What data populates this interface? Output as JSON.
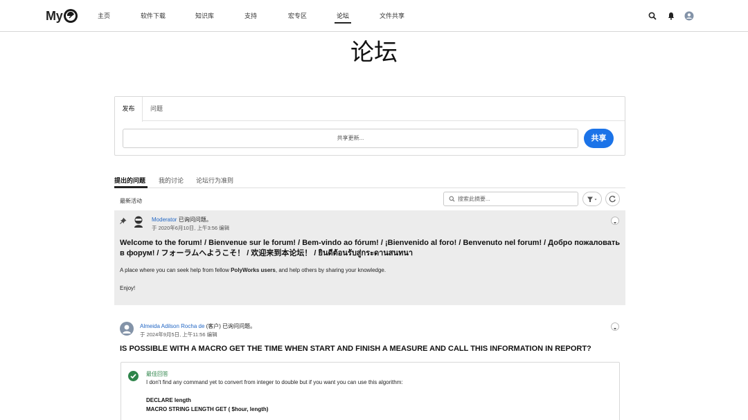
{
  "header": {
    "logo_text": "My",
    "nav": [
      {
        "label": "主页"
      },
      {
        "label": "软件下载"
      },
      {
        "label": "知识库"
      },
      {
        "label": "支持"
      },
      {
        "label": "宏专区"
      },
      {
        "label": "论坛"
      },
      {
        "label": "文件共享"
      }
    ],
    "active_nav": "论坛"
  },
  "page": {
    "title": "论坛"
  },
  "publisher": {
    "tabs": [
      "发布",
      "问题"
    ],
    "input_placeholder": "共享更新...",
    "share_label": "共享"
  },
  "feed": {
    "tabs": [
      "提出的问题",
      "我的讨论",
      "论坛行为准则"
    ],
    "activity_label": "最新活动",
    "search_placeholder": "搜索此摘要...",
    "posts": [
      {
        "author": "Moderator",
        "author_suffix": " 已询问问题。",
        "meta": "于 2020年6月10日, 上午3:56 编辑",
        "title_line1": "Welcome to the forum! / Bienvenue sur le forum! / Bem-vindo ao fórum! / ¡Bienvenido al foro! / Benvenuto nel forum! / Добро пожаловать",
        "title_line2": "в форум! / フォーラムへようこそ！ / 欢迎来到本论坛！ / ยินดีต้อนรับสู่กระดานสนทนา",
        "body_pre": "A place where you can seek help from fellow ",
        "body_bold": "PolyWorks users",
        "body_post": ", and help others by sharing your knowledge.",
        "body2": "Enjoy!"
      },
      {
        "author": "Almeida Adilson Rocha de",
        "author_suffix": " (客户) 已询问问题。",
        "meta": "于 2024年9月5日, 上午11:56 编辑",
        "title": "IS POSSIBLE WITH A MACRO GET THE TIME WHEN START AND FINISH A MEASURE AND CALL THIS INFORMATION IN REPORT?",
        "best_answer_label": "最佳回答",
        "answer_text": "I don't find any command yet to convert from integer to double but if you want you can use this algorithm:",
        "code_lines": [
          "DECLARE length",
          "MACRO STRING LENGTH GET ( $hour, length)"
        ]
      }
    ]
  },
  "colors": {
    "accent": "#1b73e8",
    "link": "#2166c4",
    "success": "#2e844a",
    "pinned_bg": "#ececec"
  },
  "icons": [
    "search-icon",
    "bell-icon",
    "user-icon",
    "pin-icon",
    "filter-icon",
    "refresh-icon",
    "chevron-down-icon",
    "check-icon"
  ]
}
